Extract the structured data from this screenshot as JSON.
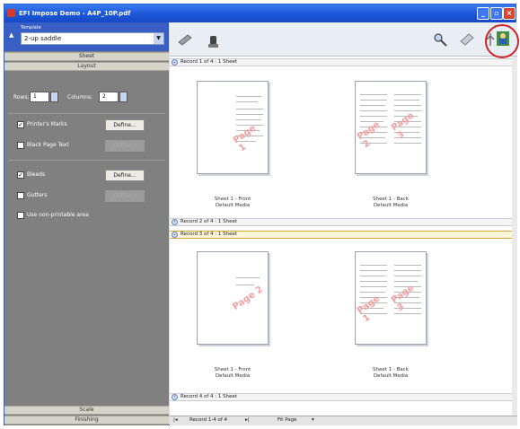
{
  "window": {
    "title": "EFI Impose Demo - A4P_10P.pdf"
  },
  "template": {
    "label": "Template",
    "value": "2-up saddle"
  },
  "sections": {
    "sheet": "Sheet",
    "layout": "Layout",
    "scale": "Scale",
    "finishing": "Finishing"
  },
  "layout": {
    "rows_label": "Rows:",
    "rows_value": "1",
    "columns_label": "Columns:",
    "columns_value": "2",
    "printers_marks": "Printer's Marks",
    "black_page_text": "Black Page Text",
    "bleeds": "Bleeds",
    "gutters": "Gutters",
    "use_non_printable": "Use non-printable area",
    "define": "Define..."
  },
  "records": [
    {
      "label": "Record 1 of 4 : 1 Sheet"
    },
    {
      "label": "Record 2 of 4 : 1 Sheet"
    },
    {
      "label": "Record 3 of 4 : 1 Sheet"
    },
    {
      "label": "Record 4 of 4 : 1 Sheet"
    }
  ],
  "sheets": [
    {
      "title": "Sheet 1 - Front",
      "media": "Default Media",
      "left_page": "",
      "right_page": "Page 1"
    },
    {
      "title": "Sheet 1 - Back",
      "media": "Default Media",
      "left_page": "Page 2",
      "right_page": "Page 3"
    },
    {
      "title": "Sheet 1 - Front",
      "media": "Default Media",
      "left_page": "",
      "right_page": "Page 2"
    },
    {
      "title": "Sheet 1 - Back",
      "media": "Default Media",
      "left_page": "Page 1",
      "right_page": "Page 3"
    }
  ],
  "statusbar": {
    "records": "Record 1-4 of 4",
    "fit": "Fit Page"
  },
  "colors": {
    "title": "#1d58d8",
    "panel": "#808080",
    "highlight": "#d12525"
  }
}
